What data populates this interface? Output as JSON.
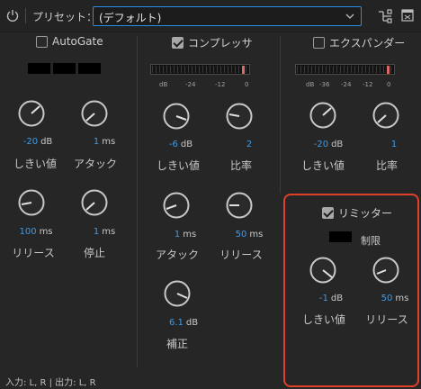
{
  "toolbar": {
    "preset_label": "プリセット：",
    "preset_value": "(デフォルト)"
  },
  "autogate": {
    "title": "AutoGate",
    "enabled": false,
    "threshold": {
      "value": "-20",
      "unit": "dB",
      "label": "しきい値"
    },
    "attack": {
      "value": "1",
      "unit": "ms",
      "label": "アタック"
    },
    "release": {
      "value": "100",
      "unit": "ms",
      "label": "リリース"
    },
    "hold": {
      "value": "1",
      "unit": "ms",
      "label": "停止"
    }
  },
  "compressor": {
    "title": "コンプレッサ",
    "enabled": true,
    "meter_scale": [
      "dB",
      "-24",
      "-12",
      "0"
    ],
    "threshold": {
      "value": "-6",
      "unit": "dB",
      "label": "しきい値"
    },
    "ratio": {
      "value": "2",
      "unit": "",
      "label": "比率"
    },
    "attack": {
      "value": "1",
      "unit": "ms",
      "label": "アタック"
    },
    "release": {
      "value": "50",
      "unit": "ms",
      "label": "リリース"
    },
    "makeup": {
      "value": "6.1",
      "unit": "dB",
      "label": "補正"
    }
  },
  "expander": {
    "title": "エクスパンダー",
    "enabled": false,
    "meter_scale": [
      "dB",
      "-36",
      "-24",
      "-12",
      "0"
    ],
    "threshold": {
      "value": "-20",
      "unit": "dB",
      "label": "しきい値"
    },
    "ratio": {
      "value": "1",
      "unit": "",
      "label": "比率"
    }
  },
  "limiter": {
    "title": "リミッター",
    "enabled": true,
    "reduction_label": "制限",
    "threshold": {
      "value": "-1",
      "unit": "dB",
      "label": "しきい値"
    },
    "release": {
      "value": "50",
      "unit": "ms",
      "label": "リリース"
    }
  },
  "footer": {
    "io_text": "入力: L, R | 出力: L, R"
  },
  "colors": {
    "accent_blue": "#3d9be9",
    "highlight_red": "#e0402a",
    "meter_peak": "#e06767"
  }
}
